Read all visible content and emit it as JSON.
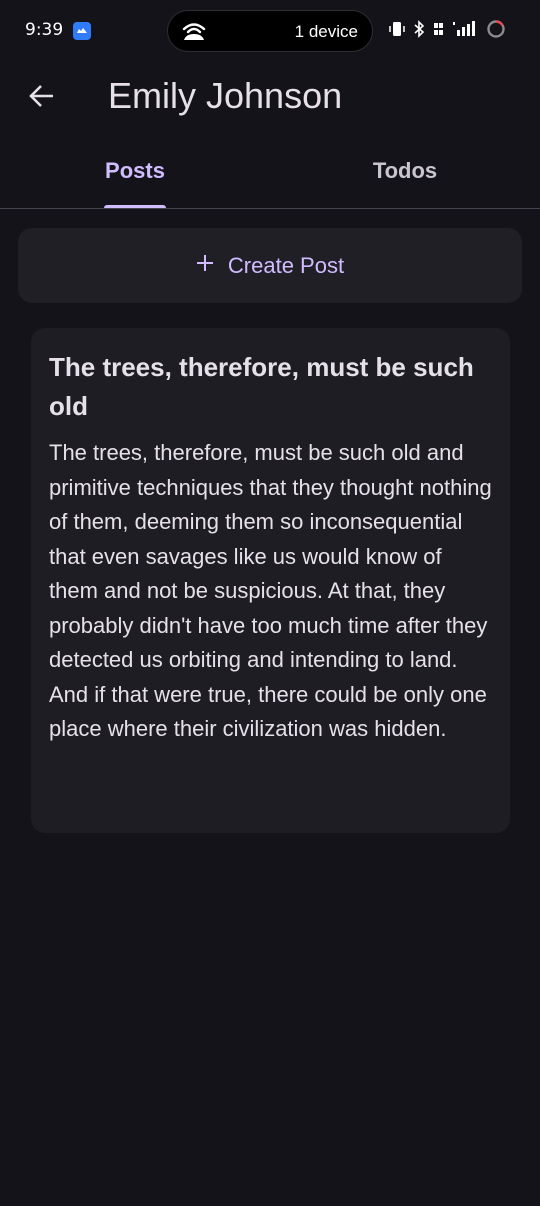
{
  "status_bar": {
    "time": "9:39",
    "pill_text": "1 device"
  },
  "app_bar": {
    "title": "Emily Johnson"
  },
  "tabs": [
    {
      "label": "Posts",
      "selected": true
    },
    {
      "label": "Todos",
      "selected": false
    }
  ],
  "create_post": {
    "label": "Create Post"
  },
  "post": {
    "title": "The trees, therefore, must be such old",
    "body": "The trees, therefore, must be such old and primitive techniques that they thought nothing of them, deeming them so inconsequential that even savages like us would know of them and not be suspicious. At that, they probably didn't have too much time after they detected us orbiting and intending to land. And if that were true, there could be only one place where their civilization was hidden."
  },
  "colors": {
    "background": "#15131a",
    "accent": "#d0bcff",
    "surface": "#211f26",
    "text": "#e6e1e8"
  }
}
